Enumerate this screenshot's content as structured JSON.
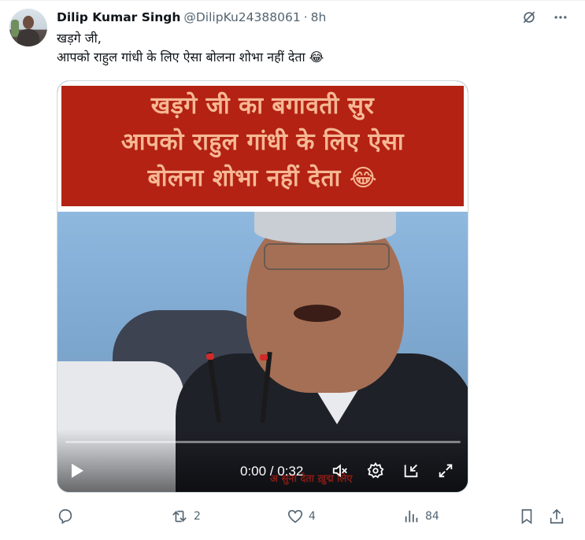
{
  "tweet": {
    "display_name": "Dilip Kumar Singh",
    "handle": "@DilipKu24388061",
    "separator": "·",
    "time": "8h",
    "text_line1": "खड़गे जी,",
    "text_line2": "आपको राहुल गांधी के लिए ऐसा बोलना शोभा नहीं देता 😂"
  },
  "media": {
    "banner_line1": "खड़गे जी का बगावती सुर",
    "banner_line2": "आपको राहुल गांधी के लिए ऐसा",
    "banner_line3": "बोलना शोभा नहीं देता 😂",
    "video_caption": "अ सुना देता ख़ुद्म लिए",
    "time_display": "0:00 / 0:32",
    "progress_percent": 0
  },
  "actions": {
    "reply_count": "",
    "retweet_count": "2",
    "like_count": "4",
    "views_count": "84"
  },
  "colors": {
    "banner_bg": "#b32213",
    "banner_text": "#f6b894",
    "icon_gray": "#536471"
  }
}
